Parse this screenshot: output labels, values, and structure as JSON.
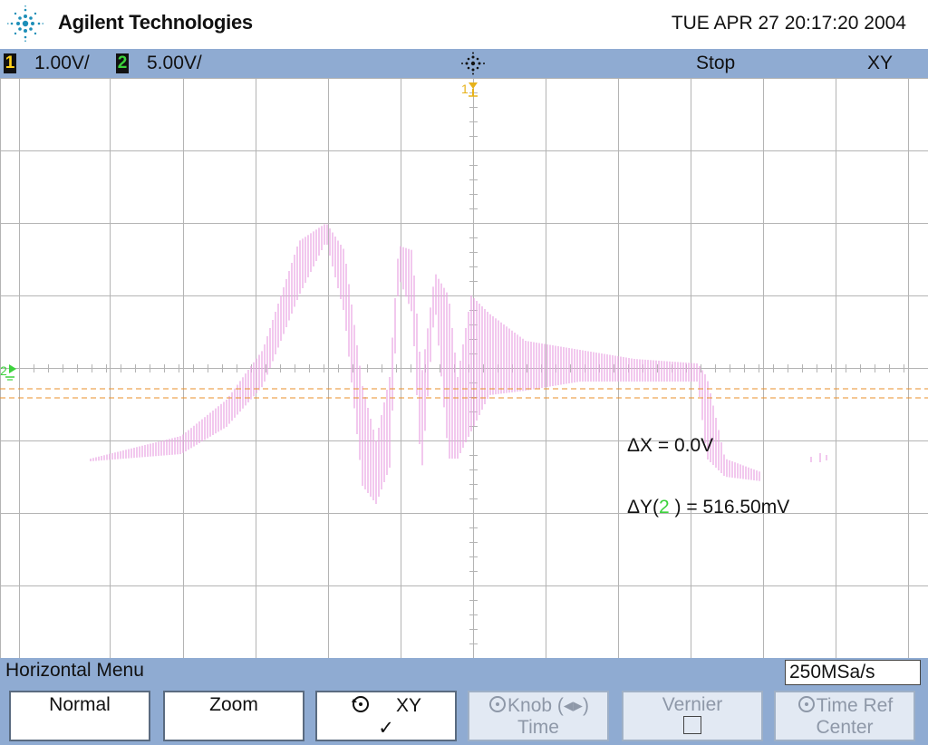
{
  "header": {
    "brand": "Agilent Technologies",
    "datetime": "TUE APR 27 20:17:20 2004",
    "logo_icon": "agilent-spark-icon"
  },
  "status_bar": {
    "ch1_num": "1",
    "ch1_scale": "1.00V/",
    "ch2_num": "2",
    "ch2_scale": "5.00V/",
    "acq_icon": "acquisition-star-icon",
    "run_state": "Stop",
    "mode": "XY"
  },
  "display": {
    "ch1_marker": "1",
    "ch2_marker": "2",
    "measurements": {
      "dx": "ΔX = 0.0V",
      "dy_prefix": "ΔY(",
      "dy_channel": "2",
      "dy_suffix": " ) = 516.50mV"
    },
    "colors": {
      "trace": "#e9a3e3",
      "cursor": "#e88f2a",
      "ch1": "#ffd21a",
      "ch2": "#3cd23c",
      "grid": "#b4b4b4"
    }
  },
  "menu": {
    "title": "Horizontal Menu",
    "sample_rate": "250MSa/s",
    "softkeys": [
      {
        "line1": "Normal",
        "line2": "",
        "enabled": true
      },
      {
        "line1": "Zoom",
        "line2": "",
        "enabled": true
      },
      {
        "line1": "XY",
        "line2": "✓",
        "enabled": true
      },
      {
        "line1": "Knob (◂▸)",
        "line2": "Time",
        "enabled": false
      },
      {
        "line1": "Vernier",
        "line2": "",
        "enabled": false
      },
      {
        "line1": "Time Ref",
        "line2": "Center",
        "enabled": false
      }
    ]
  }
}
